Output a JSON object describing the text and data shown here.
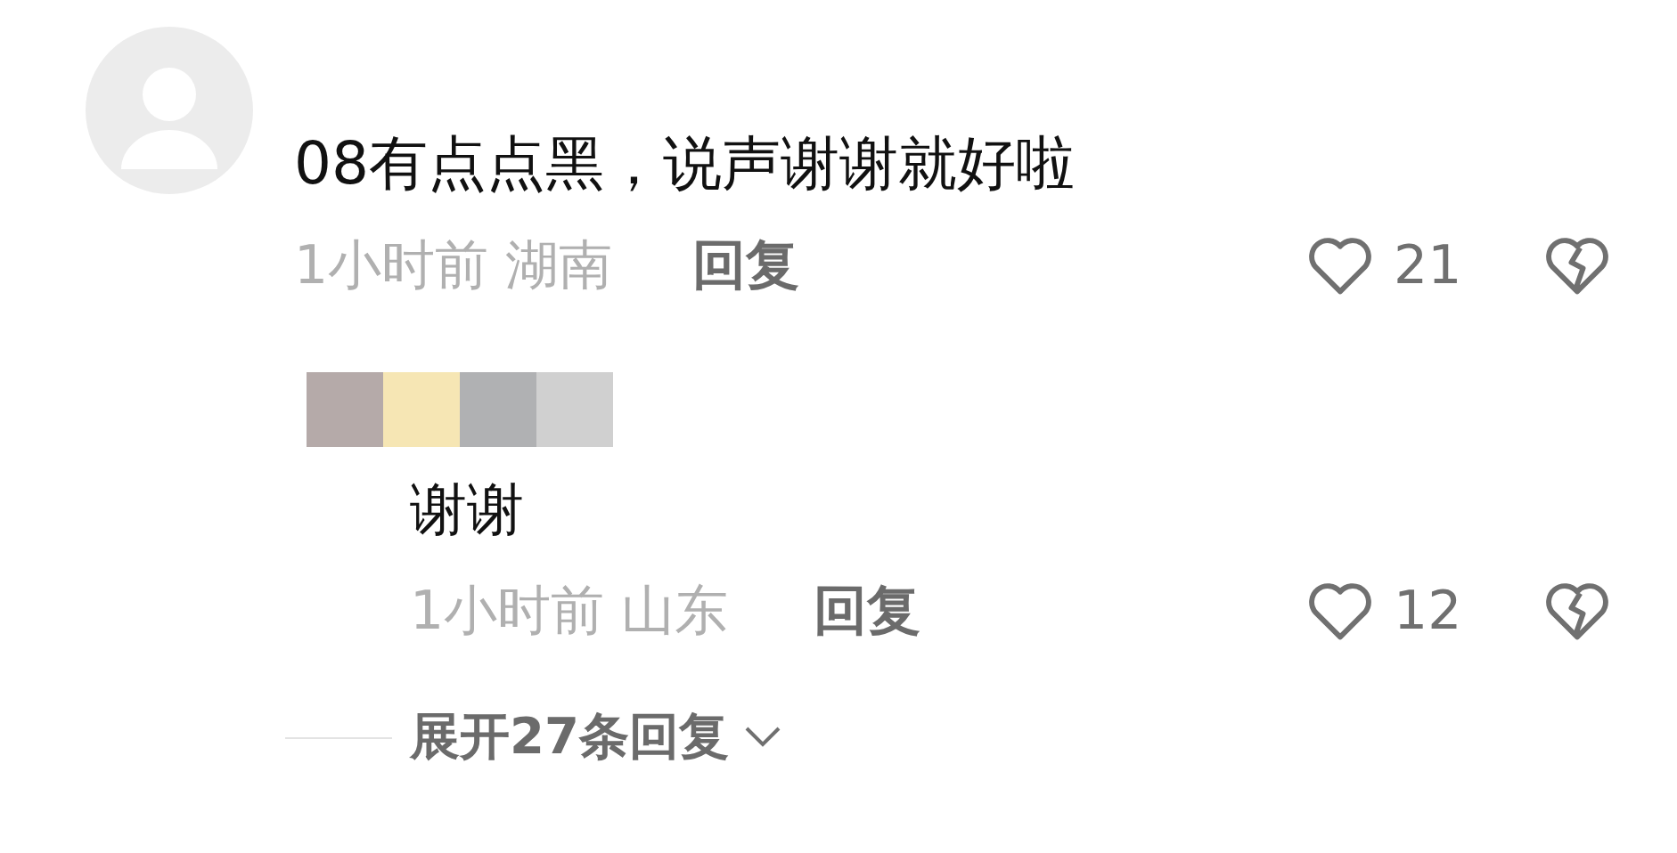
{
  "comment": {
    "text": "08有点点黑，说声谢谢就好啦",
    "time": "1小时前",
    "location": "湖南",
    "reply_label": "回复",
    "likes": "21",
    "replies": [
      {
        "text": "谢谢",
        "time": "1小时前",
        "location": "山东",
        "reply_label": "回复",
        "likes": "12"
      }
    ]
  },
  "expand_label": "展开27条回复"
}
